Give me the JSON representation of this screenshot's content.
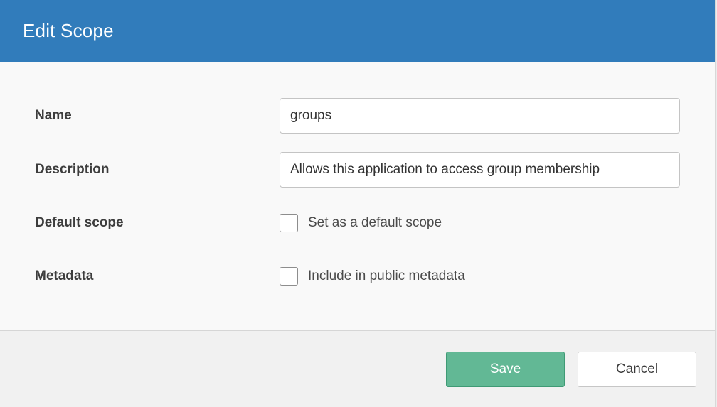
{
  "dialog": {
    "title": "Edit Scope"
  },
  "form": {
    "name": {
      "label": "Name",
      "value": "groups"
    },
    "description": {
      "label": "Description",
      "value": "Allows this application to access group membership"
    },
    "default_scope": {
      "label": "Default scope",
      "checkbox_label": "Set as a default scope",
      "checked": false
    },
    "metadata": {
      "label": "Metadata",
      "checkbox_label": "Include in public metadata",
      "checked": false
    }
  },
  "footer": {
    "save_label": "Save",
    "cancel_label": "Cancel"
  },
  "colors": {
    "header": "#317cbb",
    "save_button": "#62b895"
  }
}
